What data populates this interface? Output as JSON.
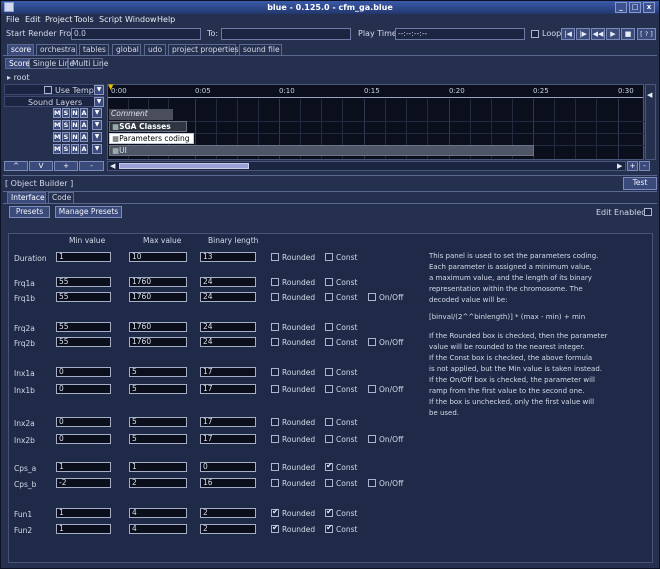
{
  "window": {
    "title": "blue - 0.125.0 - cfm_ga.blue",
    "controls": [
      "_",
      "□",
      "x"
    ]
  },
  "menu": {
    "items": [
      "File",
      "Edit",
      "Project",
      "Tools",
      "Script",
      "Window",
      "Help"
    ]
  },
  "toolbar": {
    "start_render_label": "Start Render From:",
    "start_render_value": "0.0",
    "to_label": "To:",
    "to_value": "",
    "play_time_label": "Play Time:",
    "play_time_value": "--:--:--:--",
    "loop_label": "Loop",
    "help_label": "[ ? ]"
  },
  "main_tabs": [
    "score",
    "orchestra",
    "tables",
    "global",
    "udo",
    "project properties",
    "sound file"
  ],
  "score_tabs": [
    "Score",
    "Single Line",
    "Multi Line"
  ],
  "root_label": "root",
  "left_panel": {
    "use_tempo_label": "Use Tempo",
    "sound_layers_label": "Sound Layers",
    "msna": [
      "M",
      "S",
      "N",
      "A"
    ],
    "nav_buttons": [
      "^",
      "V",
      "+",
      "-"
    ]
  },
  "timeline": {
    "ticks": [
      "0:00",
      "0:05",
      "0:10",
      "0:15",
      "0:20",
      "0:25",
      "0:30"
    ],
    "objects": [
      "Comment",
      "SGA Classes",
      "Parameters coding",
      "UI"
    ],
    "zoom_buttons": [
      "+",
      "-"
    ]
  },
  "object_builder": {
    "title": "[ Object Builder ]",
    "test_label": "Test",
    "tabs": [
      "Interface",
      "Code"
    ],
    "presets_label": "Presets",
    "manage_presets_label": "Manage Presets",
    "edit_enabled_label": "Edit Enabled:"
  },
  "params": {
    "headers": {
      "min": "Min value",
      "max": "Max value",
      "bin": "Binary length"
    },
    "rounded_label": "Rounded",
    "const_label": "Const",
    "onoff_label": "On/Off",
    "rows": [
      {
        "name": "Duration",
        "min": "1",
        "max": "10",
        "bin": "13",
        "rounded": false,
        "const": false,
        "onoff": null
      },
      {
        "name": "Frq1a",
        "min": "55",
        "max": "1760",
        "bin": "24",
        "rounded": false,
        "const": false,
        "onoff": null
      },
      {
        "name": "Frq1b",
        "min": "55",
        "max": "1760",
        "bin": "24",
        "rounded": false,
        "const": false,
        "onoff": false
      },
      {
        "name": "Frq2a",
        "min": "55",
        "max": "1760",
        "bin": "24",
        "rounded": false,
        "const": false,
        "onoff": null
      },
      {
        "name": "Frq2b",
        "min": "55",
        "max": "1760",
        "bin": "24",
        "rounded": false,
        "const": false,
        "onoff": false
      },
      {
        "name": "Inx1a",
        "min": "0",
        "max": "5",
        "bin": "17",
        "rounded": false,
        "const": false,
        "onoff": null
      },
      {
        "name": "Inx1b",
        "min": "0",
        "max": "5",
        "bin": "17",
        "rounded": false,
        "const": false,
        "onoff": false
      },
      {
        "name": "Inx2a",
        "min": "0",
        "max": "5",
        "bin": "17",
        "rounded": false,
        "const": false,
        "onoff": null
      },
      {
        "name": "Inx2b",
        "min": "0",
        "max": "5",
        "bin": "17",
        "rounded": false,
        "const": false,
        "onoff": false
      },
      {
        "name": "Cps_a",
        "min": "1",
        "max": "1",
        "bin": "0",
        "rounded": false,
        "const": true,
        "onoff": null
      },
      {
        "name": "Cps_b",
        "min": "-2",
        "max": "2",
        "bin": "16",
        "rounded": false,
        "const": false,
        "onoff": false
      },
      {
        "name": "Fun1",
        "min": "1",
        "max": "4",
        "bin": "2",
        "rounded": true,
        "const": true,
        "onoff": null
      },
      {
        "name": "Fun2",
        "min": "1",
        "max": "4",
        "bin": "2",
        "rounded": true,
        "const": true,
        "onoff": null
      }
    ]
  },
  "description": [
    "This panel is used to set the parameters coding.",
    "Each parameter is assigned a minimum value,",
    "a maximum value, and the length of its binary",
    "representation within the chromosome. The",
    "decoded value will be:",
    "",
    "[binval/(2^^binlength)] * (max - min) + min",
    "",
    "If the Rounded box is checked, then the parameter",
    "value will be rounded to the nearest integer.",
    "If the Const box is checked, the above formula",
    "is not applied, but the Min value is taken instead.",
    "If the On/Off box is checked, the parameter will",
    "ramp from the first value to the second one.",
    "If the box is unchecked, only the first value will",
    "be used."
  ]
}
